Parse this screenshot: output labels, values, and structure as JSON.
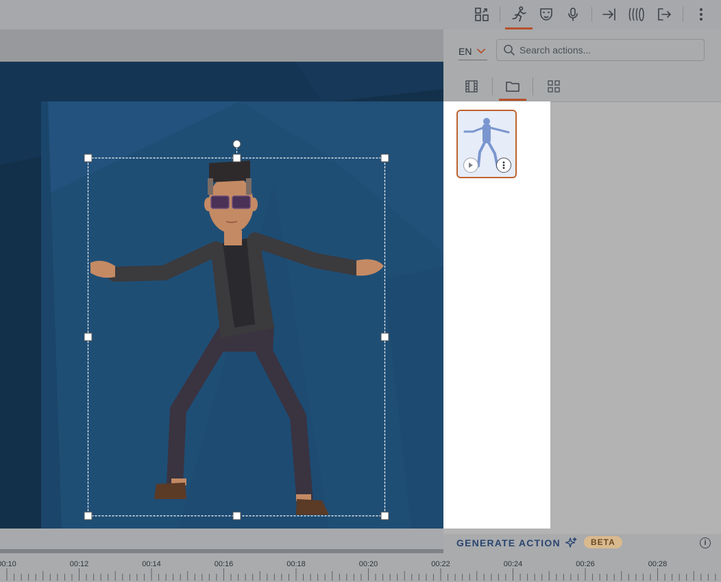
{
  "toolbar": {
    "icons": [
      "swap-panels-icon",
      "running-figure-icon",
      "mask-icon",
      "microphone-icon",
      "enter-arrow-icon",
      "motion-lines-icon",
      "exit-arrow-icon",
      "more-vertical-icon"
    ],
    "active": "running-figure-icon",
    "accent": "#b8502b"
  },
  "panel": {
    "language": "EN",
    "search_placeholder": "Search actions...",
    "tabs": [
      "film-tab",
      "folder-tab",
      "grid-tab"
    ],
    "active_tab": "folder-tab",
    "generate_label": "GENERATE ACTION",
    "beta_label": "BETA",
    "info_label": "i"
  },
  "colors": {
    "stage_dark": "#13304a",
    "stage_light": "#1f4e75",
    "selection_border": "#ffffff",
    "thumb_border": "#c0622f"
  },
  "timeline": {
    "labels": [
      "00:10",
      "00:12",
      "00:14",
      "00:16",
      "00:18",
      "00:20",
      "00:22",
      "00:24",
      "00:26",
      "00:28"
    ]
  }
}
